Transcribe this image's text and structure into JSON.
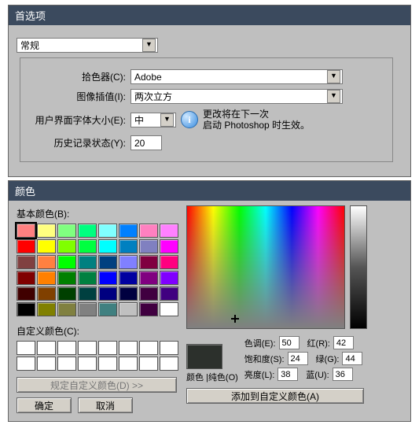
{
  "prefs": {
    "title": "首选项",
    "category_value": "常规",
    "picker_label": "拾色器(C):",
    "picker_value": "Adobe",
    "interp_label": "图像插值(I):",
    "interp_value": "两次立方",
    "fontsize_label": "用户界面字体大小(E):",
    "fontsize_value": "中",
    "info_line1": "更改将在下一次",
    "info_line2": "启动 Photoshop 时生效。",
    "history_label": "历史记录状态(Y):",
    "history_value": "20"
  },
  "colors": {
    "title": "颜色",
    "basic_label": "基本颜色(B):",
    "custom_label": "自定义颜色(C):",
    "define_custom": "规定自定义颜色(D) >>",
    "ok": "确定",
    "cancel": "取消",
    "color_solid": "颜色 |纯色(O)",
    "add_custom": "添加到自定义颜色(A)",
    "hue_label": "色调(E):",
    "sat_label": "饱和度(S):",
    "lum_label": "亮度(L):",
    "red_label": "红(R):",
    "green_label": "绿(G):",
    "blue_label": "蓝(U):",
    "hue": "50",
    "sat": "24",
    "lum": "38",
    "red": "42",
    "green": "44",
    "blue": "36",
    "basic_swatches": [
      "#ff8080",
      "#ffff80",
      "#80ff80",
      "#00ff80",
      "#80ffff",
      "#0080ff",
      "#ff80c0",
      "#ff80ff",
      "#ff0000",
      "#ffff00",
      "#80ff00",
      "#00ff40",
      "#00ffff",
      "#0080c0",
      "#8080c0",
      "#ff00ff",
      "#804040",
      "#ff8040",
      "#00ff00",
      "#008080",
      "#004080",
      "#8080ff",
      "#800040",
      "#ff0080",
      "#800000",
      "#ff8000",
      "#008000",
      "#008040",
      "#0000ff",
      "#0000a0",
      "#800080",
      "#8000ff",
      "#400000",
      "#804000",
      "#004000",
      "#004040",
      "#000080",
      "#000040",
      "#400040",
      "#400080",
      "#000000",
      "#808000",
      "#808040",
      "#808080",
      "#408080",
      "#c0c0c0",
      "#400040",
      "#ffffff"
    ],
    "custom_swatches": [
      "#ffffff",
      "#ffffff",
      "#ffffff",
      "#ffffff",
      "#ffffff",
      "#ffffff",
      "#ffffff",
      "#ffffff",
      "#ffffff",
      "#ffffff",
      "#ffffff",
      "#ffffff",
      "#ffffff",
      "#ffffff",
      "#ffffff",
      "#ffffff"
    ]
  }
}
